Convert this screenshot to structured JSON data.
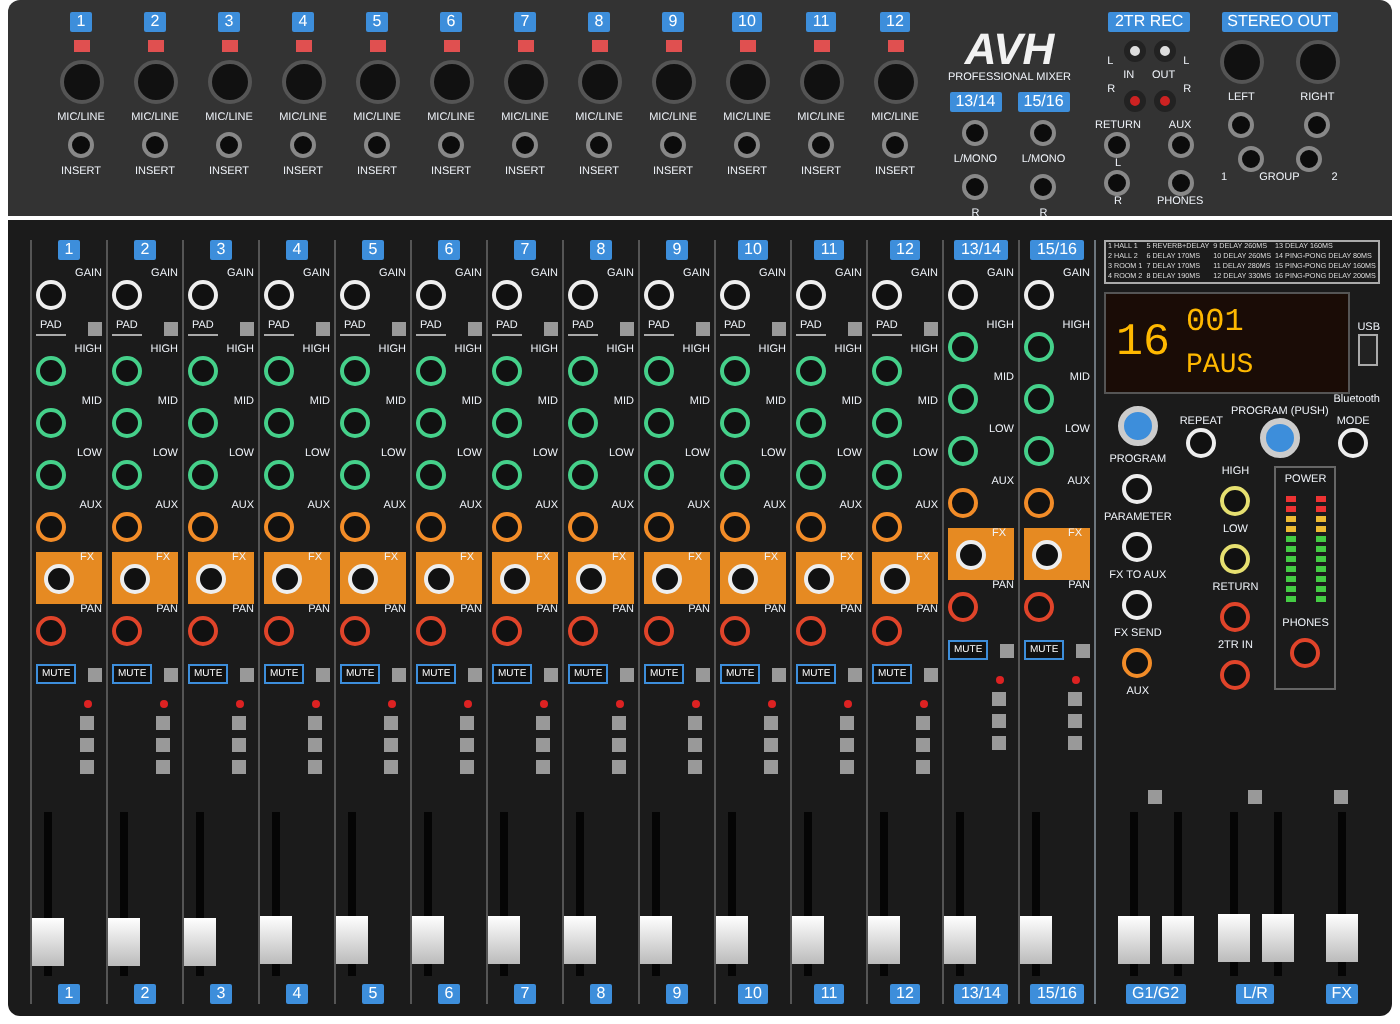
{
  "input_panel": {
    "channels": [
      {
        "label": "1",
        "jack_label": "MIC/LINE",
        "insert_label": "INSERT"
      },
      {
        "label": "2",
        "jack_label": "MIC/LINE",
        "insert_label": "INSERT"
      },
      {
        "label": "3",
        "jack_label": "MIC/LINE",
        "insert_label": "INSERT"
      },
      {
        "label": "4",
        "jack_label": "MIC/LINE",
        "insert_label": "INSERT"
      },
      {
        "label": "5",
        "jack_label": "MIC/LINE",
        "insert_label": "INSERT"
      },
      {
        "label": "6",
        "jack_label": "MIC/LINE",
        "insert_label": "INSERT"
      },
      {
        "label": "7",
        "jack_label": "MIC/LINE",
        "insert_label": "INSERT"
      },
      {
        "label": "8",
        "jack_label": "MIC/LINE",
        "insert_label": "INSERT"
      },
      {
        "label": "9",
        "jack_label": "MIC/LINE",
        "insert_label": "INSERT"
      },
      {
        "label": "10",
        "jack_label": "MIC/LINE",
        "insert_label": "INSERT"
      },
      {
        "label": "11",
        "jack_label": "MIC/LINE",
        "insert_label": "INSERT"
      },
      {
        "label": "12",
        "jack_label": "MIC/LINE",
        "insert_label": "INSERT"
      }
    ],
    "brand": {
      "logo": "AVH",
      "subtitle": "PROFESSIONAL MIXER"
    },
    "stereo_inputs": [
      {
        "label": "13/14",
        "upper_label": "L/MONO",
        "lower_label": "R"
      },
      {
        "label": "15/16",
        "upper_label": "L/MONO",
        "lower_label": "R"
      }
    ],
    "rec": {
      "title": "2TR REC",
      "left_labels": [
        "L",
        "R"
      ],
      "right_labels": [
        "L",
        "R"
      ],
      "in_label": "IN",
      "out_label": "OUT"
    },
    "returns": [
      {
        "label": "RETURN",
        "middle_label": "L",
        "bottom_label": "R"
      },
      {
        "label": "AUX",
        "bottom_label": "PHONES"
      }
    ],
    "stereo_out": {
      "title": "STEREO OUT",
      "xlr_labels": [
        "LEFT",
        "RIGHT"
      ],
      "group_labels": [
        "1",
        "GROUP",
        "2"
      ]
    }
  },
  "strips": [
    {
      "label": "1",
      "controls": [
        {
          "label": "GAIN",
          "kind": "gain"
        },
        {
          "label": "PAD",
          "kind": "pad"
        },
        {
          "label": "HIGH",
          "kind": "eq"
        },
        {
          "label": "MID",
          "kind": "eq"
        },
        {
          "label": "LOW",
          "kind": "eq"
        },
        {
          "label": "AUX",
          "kind": "aux"
        },
        {
          "label": "FX",
          "kind": "fx"
        },
        {
          "label": "PAN",
          "kind": "pan"
        }
      ],
      "mute": "MUTE",
      "level": 0.08,
      "footer": "1"
    },
    {
      "label": "2",
      "controls": [
        {
          "label": "GAIN",
          "kind": "gain"
        },
        {
          "label": "PAD",
          "kind": "pad"
        },
        {
          "label": "HIGH",
          "kind": "eq"
        },
        {
          "label": "MID",
          "kind": "eq"
        },
        {
          "label": "LOW",
          "kind": "eq"
        },
        {
          "label": "AUX",
          "kind": "aux"
        },
        {
          "label": "FX",
          "kind": "fx"
        },
        {
          "label": "PAN",
          "kind": "pan"
        }
      ],
      "mute": "MUTE",
      "level": 0.08,
      "footer": "2"
    },
    {
      "label": "3",
      "controls": [
        {
          "label": "GAIN",
          "kind": "gain"
        },
        {
          "label": "PAD",
          "kind": "pad"
        },
        {
          "label": "HIGH",
          "kind": "eq"
        },
        {
          "label": "MID",
          "kind": "eq"
        },
        {
          "label": "LOW",
          "kind": "eq"
        },
        {
          "label": "AUX",
          "kind": "aux"
        },
        {
          "label": "FX",
          "kind": "fx"
        },
        {
          "label": "PAN",
          "kind": "pan"
        }
      ],
      "mute": "MUTE",
      "level": 0.08,
      "footer": "3"
    },
    {
      "label": "4",
      "controls": [
        {
          "label": "GAIN",
          "kind": "gain"
        },
        {
          "label": "PAD",
          "kind": "pad"
        },
        {
          "label": "HIGH",
          "kind": "eq"
        },
        {
          "label": "MID",
          "kind": "eq"
        },
        {
          "label": "LOW",
          "kind": "eq"
        },
        {
          "label": "AUX",
          "kind": "aux"
        },
        {
          "label": "FX",
          "kind": "fx"
        },
        {
          "label": "PAN",
          "kind": "pan"
        }
      ],
      "mute": "MUTE",
      "level": 0.1,
      "footer": "4"
    },
    {
      "label": "5",
      "controls": [
        {
          "label": "GAIN",
          "kind": "gain"
        },
        {
          "label": "PAD",
          "kind": "pad"
        },
        {
          "label": "HIGH",
          "kind": "eq"
        },
        {
          "label": "MID",
          "kind": "eq"
        },
        {
          "label": "LOW",
          "kind": "eq"
        },
        {
          "label": "AUX",
          "kind": "aux"
        },
        {
          "label": "FX",
          "kind": "fx"
        },
        {
          "label": "PAN",
          "kind": "pan"
        }
      ],
      "mute": "MUTE",
      "level": 0.1,
      "footer": "5"
    },
    {
      "label": "6",
      "controls": [
        {
          "label": "GAIN",
          "kind": "gain"
        },
        {
          "label": "PAD",
          "kind": "pad"
        },
        {
          "label": "HIGH",
          "kind": "eq"
        },
        {
          "label": "MID",
          "kind": "eq"
        },
        {
          "label": "LOW",
          "kind": "eq"
        },
        {
          "label": "AUX",
          "kind": "aux"
        },
        {
          "label": "FX",
          "kind": "fx"
        },
        {
          "label": "PAN",
          "kind": "pan"
        }
      ],
      "mute": "MUTE",
      "level": 0.1,
      "footer": "6"
    },
    {
      "label": "7",
      "controls": [
        {
          "label": "GAIN",
          "kind": "gain"
        },
        {
          "label": "PAD",
          "kind": "pad"
        },
        {
          "label": "HIGH",
          "kind": "eq"
        },
        {
          "label": "MID",
          "kind": "eq"
        },
        {
          "label": "LOW",
          "kind": "eq"
        },
        {
          "label": "AUX",
          "kind": "aux"
        },
        {
          "label": "FX",
          "kind": "fx"
        },
        {
          "label": "PAN",
          "kind": "pan"
        }
      ],
      "mute": "MUTE",
      "level": 0.1,
      "footer": "7"
    },
    {
      "label": "8",
      "controls": [
        {
          "label": "GAIN",
          "kind": "gain"
        },
        {
          "label": "PAD",
          "kind": "pad"
        },
        {
          "label": "HIGH",
          "kind": "eq"
        },
        {
          "label": "MID",
          "kind": "eq"
        },
        {
          "label": "LOW",
          "kind": "eq"
        },
        {
          "label": "AUX",
          "kind": "aux"
        },
        {
          "label": "FX",
          "kind": "fx"
        },
        {
          "label": "PAN",
          "kind": "pan"
        }
      ],
      "mute": "MUTE",
      "level": 0.1,
      "footer": "8"
    },
    {
      "label": "9",
      "controls": [
        {
          "label": "GAIN",
          "kind": "gain"
        },
        {
          "label": "PAD",
          "kind": "pad"
        },
        {
          "label": "HIGH",
          "kind": "eq"
        },
        {
          "label": "MID",
          "kind": "eq"
        },
        {
          "label": "LOW",
          "kind": "eq"
        },
        {
          "label": "AUX",
          "kind": "aux"
        },
        {
          "label": "FX",
          "kind": "fx"
        },
        {
          "label": "PAN",
          "kind": "pan"
        }
      ],
      "mute": "MUTE",
      "level": 0.1,
      "footer": "9"
    },
    {
      "label": "10",
      "controls": [
        {
          "label": "GAIN",
          "kind": "gain"
        },
        {
          "label": "PAD",
          "kind": "pad"
        },
        {
          "label": "HIGH",
          "kind": "eq"
        },
        {
          "label": "MID",
          "kind": "eq"
        },
        {
          "label": "LOW",
          "kind": "eq"
        },
        {
          "label": "AUX",
          "kind": "aux"
        },
        {
          "label": "FX",
          "kind": "fx"
        },
        {
          "label": "PAN",
          "kind": "pan"
        }
      ],
      "mute": "MUTE",
      "level": 0.1,
      "footer": "10"
    },
    {
      "label": "11",
      "controls": [
        {
          "label": "GAIN",
          "kind": "gain"
        },
        {
          "label": "PAD",
          "kind": "pad"
        },
        {
          "label": "HIGH",
          "kind": "eq"
        },
        {
          "label": "MID",
          "kind": "eq"
        },
        {
          "label": "LOW",
          "kind": "eq"
        },
        {
          "label": "AUX",
          "kind": "aux"
        },
        {
          "label": "FX",
          "kind": "fx"
        },
        {
          "label": "PAN",
          "kind": "pan"
        }
      ],
      "mute": "MUTE",
      "level": 0.1,
      "footer": "11"
    },
    {
      "label": "12",
      "controls": [
        {
          "label": "GAIN",
          "kind": "gain"
        },
        {
          "label": "PAD",
          "kind": "pad"
        },
        {
          "label": "HIGH",
          "kind": "eq"
        },
        {
          "label": "MID",
          "kind": "eq"
        },
        {
          "label": "LOW",
          "kind": "eq"
        },
        {
          "label": "AUX",
          "kind": "aux"
        },
        {
          "label": "FX",
          "kind": "fx"
        },
        {
          "label": "PAN",
          "kind": "pan"
        }
      ],
      "mute": "MUTE",
      "level": 0.1,
      "footer": "12"
    },
    {
      "label": "13/14",
      "controls": [
        {
          "label": "GAIN",
          "kind": "gain"
        },
        {
          "label": "HIGH",
          "kind": "eq"
        },
        {
          "label": "MID",
          "kind": "eq"
        },
        {
          "label": "LOW",
          "kind": "eq"
        },
        {
          "label": "AUX",
          "kind": "aux"
        },
        {
          "label": "FX",
          "kind": "fx"
        },
        {
          "label": "PAN",
          "kind": "pan"
        }
      ],
      "mute": "MUTE",
      "level": 0.1,
      "footer": "13/14"
    },
    {
      "label": "15/16",
      "controls": [
        {
          "label": "GAIN",
          "kind": "gain"
        },
        {
          "label": "HIGH",
          "kind": "eq"
        },
        {
          "label": "MID",
          "kind": "eq"
        },
        {
          "label": "LOW",
          "kind": "eq"
        },
        {
          "label": "AUX",
          "kind": "aux"
        },
        {
          "label": "FX",
          "kind": "fx"
        },
        {
          "label": "PAN",
          "kind": "pan"
        }
      ],
      "mute": "MUTE",
      "level": 0.1,
      "footer": "15/16"
    }
  ],
  "master": {
    "effects": [
      "1 HALL 1",
      "2 HALL 2",
      "3 ROOM 1",
      "4 ROOM 2",
      "5 REVERB+DELAY",
      "6 DELAY 170MS",
      "7 DELAY 170MS",
      "8 DELAY 190MS",
      "9 DELAY 260MS",
      "10 DELAY 260MS",
      "11 DELAY 280MS",
      "12 DELAY 330MS",
      "13 DELAY 160MS",
      "14 PING-PONG DELAY 80MS",
      "15 PING-PONG DELAY 160MS",
      "16 PING-PONG DELAY 200MS"
    ],
    "display": {
      "program": "16",
      "counter": "001",
      "status": "PAUS"
    },
    "usb_label": "USB",
    "bluetooth_label": "Bluetooth",
    "left_controls": [
      {
        "label": "PROGRAM",
        "kind": "encoder"
      },
      {
        "label": "PARAMETER",
        "kind": "gain"
      },
      {
        "label": "FX TO AUX",
        "kind": "gain"
      },
      {
        "label": "FX SEND",
        "kind": "gain"
      },
      {
        "label": "AUX",
        "kind": "aux"
      }
    ],
    "player_buttons": [
      {
        "label": "REPEAT",
        "kind": "button"
      },
      {
        "label": "PROGRAM (PUSH)",
        "kind": "encoder"
      },
      {
        "label": "MODE",
        "kind": "button"
      }
    ],
    "right_controls": [
      {
        "label": "HIGH",
        "kind": "yellow"
      },
      {
        "label": "LOW",
        "kind": "yellow"
      },
      {
        "label": "RETURN",
        "kind": "pan"
      },
      {
        "label": "2TR IN",
        "kind": "pan"
      }
    ],
    "meter": {
      "power_label": "POWER",
      "phones_label": "PHONES"
    },
    "faders": [
      {
        "label": "G1/G2",
        "kind": "double",
        "level": 0.1
      },
      {
        "label": "L/R",
        "kind": "double",
        "level": 0.12
      },
      {
        "label": "FX",
        "kind": "single",
        "level": 0.12
      }
    ]
  }
}
